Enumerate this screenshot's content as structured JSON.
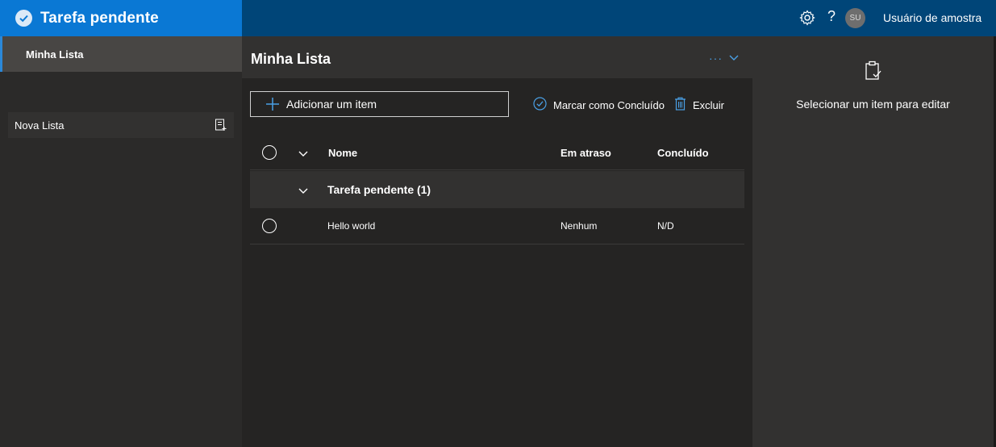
{
  "app": {
    "title": "Tarefa pendente",
    "accent_color": "#0a78d4",
    "header_color": "#004578"
  },
  "topbar": {
    "settings_icon": "gear-icon",
    "help_label": "?",
    "avatar_initials": "SU",
    "user_name": "Usuário de amostra"
  },
  "sidebar": {
    "items": [
      {
        "label": "Minha Lista",
        "active": true
      }
    ],
    "new_list_label": "Nova Lista"
  },
  "main": {
    "title": "Minha Lista",
    "more_label": "···",
    "add_item_placeholder": "Adicionar um item",
    "mark_complete_label": "Marcar como Concluído",
    "delete_label": "Excluir",
    "columns": {
      "name": "Nome",
      "overdue": "Em atraso",
      "completed": "Concluído"
    },
    "group": {
      "label": "Tarefa pendente (1)"
    },
    "rows": [
      {
        "name": "Hello world",
        "overdue": "Nenhum",
        "completed": "N/D"
      }
    ]
  },
  "details": {
    "empty_label": "Selecionar um item para editar"
  }
}
